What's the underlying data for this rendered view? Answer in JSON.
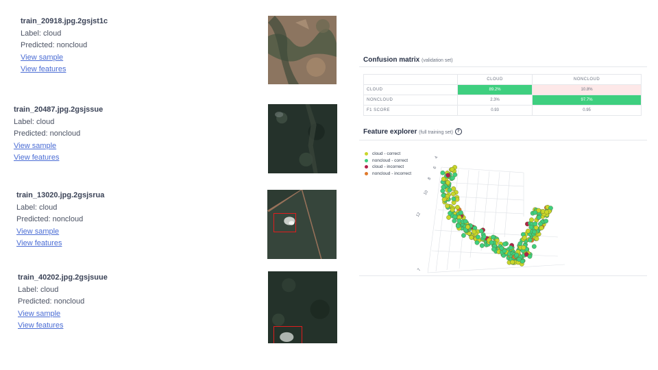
{
  "samples": [
    {
      "name": "train_20918.jpg.2gsjst1c",
      "label": "Label: cloud",
      "predicted": "Predicted: noncloud",
      "view_sample": "View sample",
      "view_features": "View features"
    },
    {
      "name": "train_20487.jpg.2gsjssue",
      "label": "Label: cloud",
      "predicted": "Predicted: noncloud",
      "view_sample": "View sample",
      "view_features": "View features"
    },
    {
      "name": "train_13020.jpg.2gsjsrua",
      "label": "Label: cloud",
      "predicted": "Predicted: noncloud",
      "view_sample": "View sample",
      "view_features": "View features"
    },
    {
      "name": "train_40202.jpg.2gsjsuue",
      "label": "Label: cloud",
      "predicted": "Predicted: noncloud",
      "view_sample": "View sample",
      "view_features": "View features"
    }
  ],
  "confusion": {
    "title": "Confusion matrix",
    "subtitle": "(validation set)",
    "col_headers": [
      "CLOUD",
      "NONCLOUD"
    ],
    "rows": [
      {
        "label": "CLOUD",
        "values": [
          "89.2%",
          "10.8%"
        ]
      },
      {
        "label": "NONCLOUD",
        "values": [
          "2.3%",
          "97.7%"
        ]
      },
      {
        "label": "F1 SCORE",
        "values": [
          "0.93",
          "0.95"
        ]
      }
    ],
    "good_color": "#3ecf7f",
    "bad_color": "#fde8e8"
  },
  "explorer": {
    "title": "Feature explorer",
    "subtitle": "(full training set)",
    "help_icon": "question-circle-icon",
    "legend": [
      {
        "label": "cloud - correct",
        "color": "#c9d62a"
      },
      {
        "label": "noncloud - correct",
        "color": "#3ecf7f"
      },
      {
        "label": "cloud - incorrect",
        "color": "#b1204a"
      },
      {
        "label": "noncloud - incorrect",
        "color": "#e0792b"
      }
    ],
    "axis_ticks": [
      "4",
      "6",
      "8",
      "10",
      "12",
      "7"
    ]
  }
}
